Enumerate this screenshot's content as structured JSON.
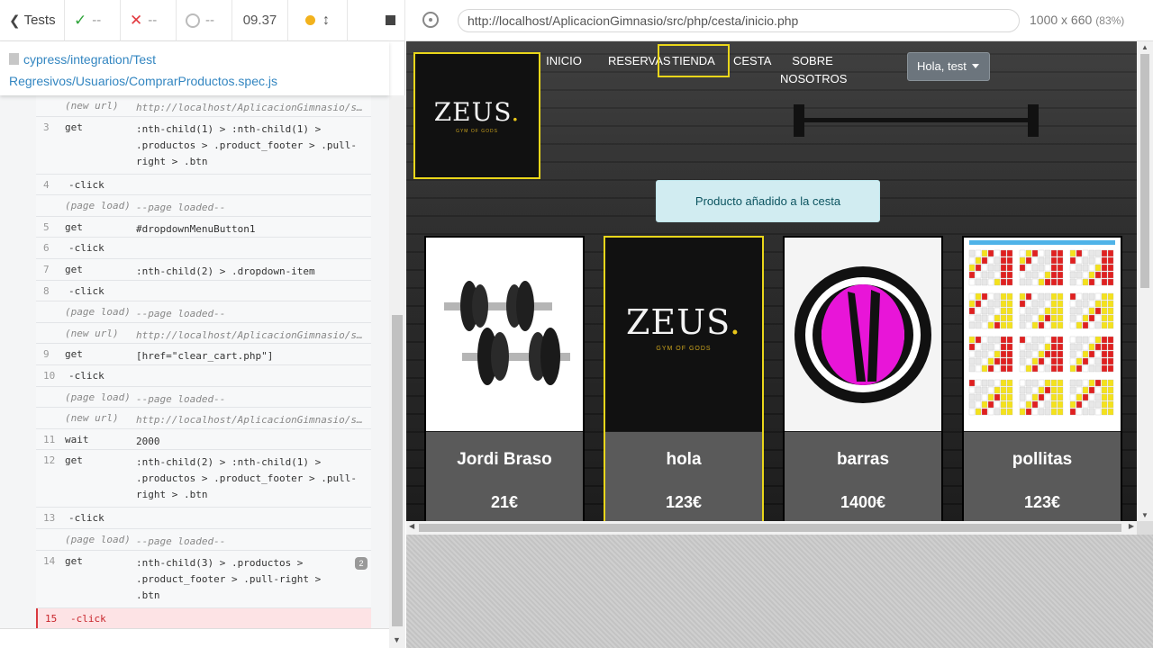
{
  "reporter": {
    "tests_label": "Tests",
    "passed": "--",
    "failed": "--",
    "pending": "--",
    "duration": "09.37",
    "spec_path_line1": "cypress/integration/Test",
    "spec_path_line2": "Regresivos/Usuarios/ComprarProductos.spec.js",
    "commands": [
      {
        "num": "",
        "name": "(new url)",
        "msg": "http://localhost/AplicacionGimnasio/s...",
        "type": "meta"
      },
      {
        "num": "3",
        "name": "get",
        "msg": ":nth-child(1) > :nth-child(1) >\n.productos > .product_footer > .pull-\nright > .btn",
        "type": "cmd"
      },
      {
        "num": "4",
        "name": "-click",
        "msg": "",
        "type": "child"
      },
      {
        "num": "",
        "name": "(page load)",
        "msg": "--page loaded--",
        "type": "meta"
      },
      {
        "num": "5",
        "name": "get",
        "msg": "#dropdownMenuButton1",
        "type": "cmd"
      },
      {
        "num": "6",
        "name": "-click",
        "msg": "",
        "type": "child"
      },
      {
        "num": "7",
        "name": "get",
        "msg": ":nth-child(2) > .dropdown-item",
        "type": "cmd"
      },
      {
        "num": "8",
        "name": "-click",
        "msg": "",
        "type": "child"
      },
      {
        "num": "",
        "name": "(page load)",
        "msg": "--page loaded--",
        "type": "meta"
      },
      {
        "num": "",
        "name": "(new url)",
        "msg": "http://localhost/AplicacionGimnasio/s...",
        "type": "meta"
      },
      {
        "num": "9",
        "name": "get",
        "msg": "[href=\"clear_cart.php\"]",
        "type": "cmd"
      },
      {
        "num": "10",
        "name": "-click",
        "msg": "",
        "type": "child"
      },
      {
        "num": "",
        "name": "(page load)",
        "msg": "--page loaded--",
        "type": "meta"
      },
      {
        "num": "",
        "name": "(new url)",
        "msg": "http://localhost/AplicacionGimnasio/s...",
        "type": "meta"
      },
      {
        "num": "11",
        "name": "wait",
        "msg": "2000",
        "type": "cmd"
      },
      {
        "num": "12",
        "name": "get",
        "msg": ":nth-child(2) > :nth-child(1) >\n.productos > .product_footer > .pull-\nright > .btn",
        "type": "cmd"
      },
      {
        "num": "13",
        "name": "-click",
        "msg": "",
        "type": "child"
      },
      {
        "num": "",
        "name": "(page load)",
        "msg": "--page loaded--",
        "type": "meta"
      },
      {
        "num": "14",
        "name": "get",
        "msg": ":nth-child(3) > .productos >\n.product_footer > .pull-right >\n.btn",
        "type": "cmd",
        "badge": "2"
      },
      {
        "num": "15",
        "name": "-click",
        "msg": "",
        "type": "fail"
      }
    ]
  },
  "runner": {
    "url": "http://localhost/AplicacionGimnasio/src/php/cesta/inicio.php",
    "viewport": "1000 x 660",
    "scale": "(83%)"
  },
  "site": {
    "logo_text": "ZEUS",
    "logo_dot": ".",
    "logo_tagline": "GYM OF GODS",
    "nav": [
      "INICIO",
      "RESERVAS",
      "TIENDA",
      "CESTA",
      "SOBRE NOSOTROS"
    ],
    "user_button": "Hola, test",
    "alert": "Producto añadido a la cesta",
    "products": [
      {
        "title": "Jordi Braso",
        "price": "21€"
      },
      {
        "title": "hola",
        "price": "123€"
      },
      {
        "title": "barras",
        "price": "1400€"
      },
      {
        "title": "pollitas",
        "price": "123€"
      }
    ]
  },
  "colors": {
    "accent_yellow": "#e9d61a",
    "pass_green": "#2fa43a",
    "fail_red": "#e2393f",
    "link_blue": "#3386c1",
    "alert_bg": "#d1ecf1"
  }
}
